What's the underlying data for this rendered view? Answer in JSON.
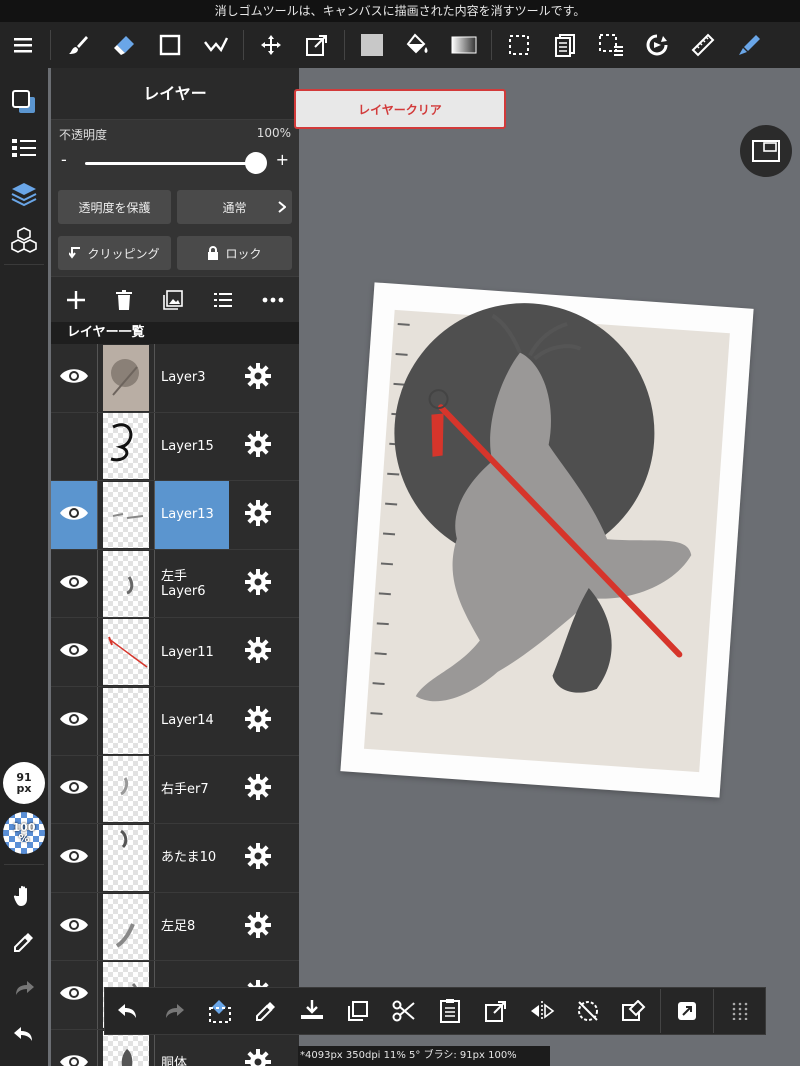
{
  "hint": "消しゴムツールは、キャンバスに描画された内容を消すツールです。",
  "toolbar": {
    "icons": [
      "menu-icon",
      "brush-icon",
      "eraser-icon",
      "shape-icon",
      "correction-pen-icon",
      "move-icon",
      "transform-icon",
      "fill-color-icon",
      "fill-bucket-icon",
      "gradient-icon",
      "select-icon",
      "copy-paste-icon",
      "selection-tool-icon",
      "rotate-icon",
      "ruler-icon",
      "pen-icon"
    ]
  },
  "colors": {
    "accent": "#5b95cf",
    "danger": "#d23a3a",
    "brush": "#d6352b"
  },
  "rail": {
    "brush_size": "91\npx",
    "opacity": "100\n%"
  },
  "layer_panel": {
    "title": "レイヤー",
    "opacity_label": "不透明度",
    "opacity_value": "100%",
    "opacity_fraction": 1.0,
    "minus": "-",
    "plus": "+",
    "protect_alpha": "透明度を保護",
    "blend_mode": "通常",
    "clipping": "クリッピング",
    "lock": "ロック",
    "list_header": "レイヤー一覧",
    "layers": [
      {
        "name": "Layer3",
        "visible": true,
        "selected": false
      },
      {
        "name": "Layer15",
        "visible": false,
        "selected": false
      },
      {
        "name": "Layer13",
        "visible": true,
        "selected": true
      },
      {
        "name": "左手\nLayer6",
        "visible": true,
        "selected": false
      },
      {
        "name": "Layer11",
        "visible": true,
        "selected": false
      },
      {
        "name": "Layer14",
        "visible": true,
        "selected": false
      },
      {
        "name": "右手er7",
        "visible": true,
        "selected": false
      },
      {
        "name": "あたま10",
        "visible": true,
        "selected": false
      },
      {
        "name": "左足8",
        "visible": true,
        "selected": false
      },
      {
        "name": "",
        "visible": true,
        "selected": false
      },
      {
        "name": "胴体",
        "visible": true,
        "selected": false
      }
    ]
  },
  "popup": {
    "label": "レイヤークリア"
  },
  "status": "*4093px 350dpi 11% 5° ブラシ: 91px 100%"
}
